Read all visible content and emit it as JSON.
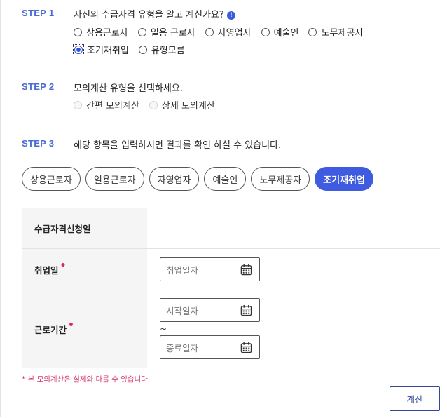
{
  "steps": [
    {
      "label": "STEP 1",
      "text": "자신의 수급자격 유형을 알고 계신가요?"
    },
    {
      "label": "STEP 2",
      "text": "모의계산 유형을 선택하세요."
    },
    {
      "label": "STEP 3",
      "text": "해당 항목을 입력하시면 결과를 확인 하실 수 있습니다."
    }
  ],
  "step1_options": [
    "상용근로자",
    "일용 근로자",
    "자영업자",
    "예술인",
    "노무제공자",
    "조기재취업",
    "유형모름"
  ],
  "step1_selected": "조기재취업",
  "step2_options": [
    "간편 모의계산",
    "상세 모의계산"
  ],
  "tabs": [
    "상용근로자",
    "일용근로자",
    "자영업자",
    "예술인",
    "노무제공자",
    "조기재취업"
  ],
  "active_tab": "조기재취업",
  "form": {
    "apply_date_label": "수급자격신청일",
    "reemploy_label": "취업일",
    "reemploy_placeholder": "취업일자",
    "work_period_label": "근로기간",
    "start_placeholder": "시작일자",
    "tilde": "~",
    "end_placeholder": "종료일자"
  },
  "notice": "* 본 모의계산은 실제와 다를 수 있습니다.",
  "calc_button": "계산",
  "colors": {
    "accent": "#3f5ce0",
    "step": "#4a6bd6",
    "required": "#e0245e",
    "notice": "#d6336c"
  }
}
